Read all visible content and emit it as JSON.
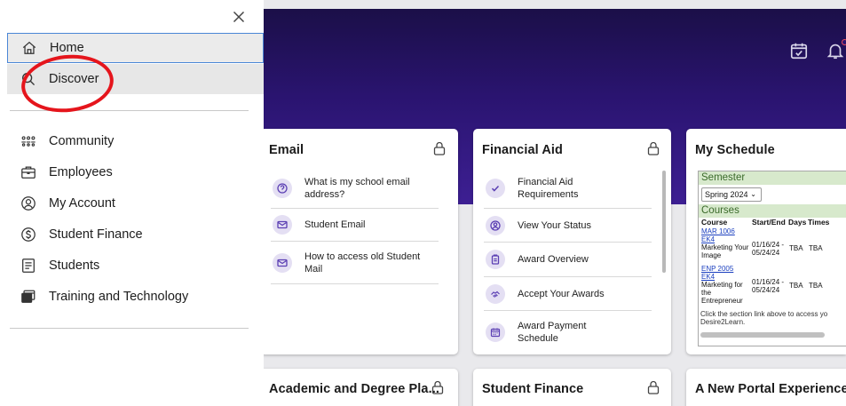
{
  "drawer": {
    "close_label": "×",
    "nav_primary": [
      {
        "label": "Home",
        "icon": "home-icon"
      },
      {
        "label": "Discover",
        "icon": "search-icon"
      }
    ],
    "nav_secondary": [
      {
        "label": "Community",
        "icon": "community-icon"
      },
      {
        "label": "Employees",
        "icon": "briefcase-icon"
      },
      {
        "label": "My Account",
        "icon": "account-icon"
      },
      {
        "label": "Student Finance",
        "icon": "dollar-icon"
      },
      {
        "label": "Students",
        "icon": "document-icon"
      },
      {
        "label": "Training and Technology",
        "icon": "window-icon"
      }
    ]
  },
  "cards": {
    "email": {
      "title": "Email",
      "items": [
        "What is my school email address?",
        "Student Email",
        "How to access old Student Mail"
      ]
    },
    "financial_aid": {
      "title": "Financial Aid",
      "items": [
        "Financial Aid Requirements",
        "View Your Status",
        "Award Overview",
        "Accept Your Awards",
        "Award Payment Schedule"
      ]
    },
    "schedule": {
      "title": "My Schedule",
      "semester_label": "Semester",
      "semester_value": "Spring 2024",
      "courses_label": "Courses",
      "headers": [
        "Course",
        "Start/End",
        "Days",
        "Times"
      ],
      "courses": [
        {
          "code": "MAR 1006",
          "section": "EK4",
          "name": "Marketing Your Image",
          "dates": "01/16/24 - 05/24/24",
          "days": "TBA",
          "times": "TBA"
        },
        {
          "code": "ENP 2005",
          "section": "EK4",
          "name": "Marketing for the Entrepreneur",
          "dates": "01/16/24 - 05/24/24",
          "days": "TBA",
          "times": "TBA"
        }
      ],
      "note": "Click the section link above to access yo Desire2Learn."
    },
    "bottom": [
      {
        "title": "Academic and Degree Pla..."
      },
      {
        "title": "Student Finance"
      },
      {
        "title": "A New Portal Experience"
      }
    ]
  },
  "colors": {
    "header_purple": "#2a1470",
    "accent_purple": "#5b3fb3",
    "focus_blue": "#4a86d6",
    "annotation_red": "#e5151c"
  }
}
